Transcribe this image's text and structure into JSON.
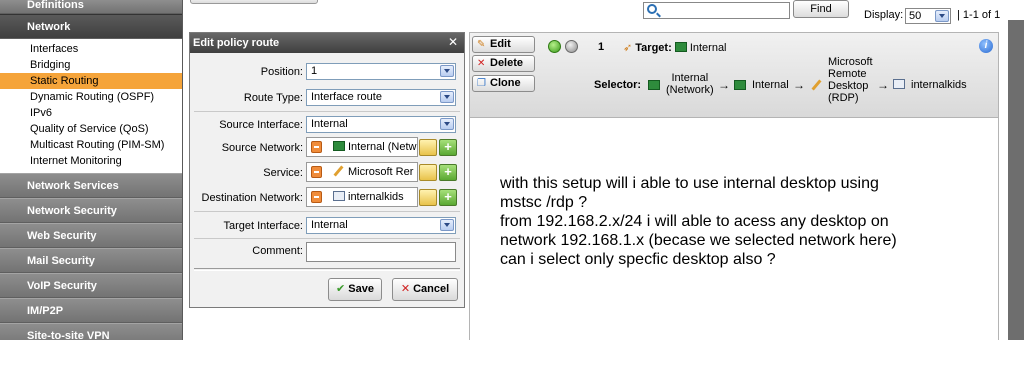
{
  "sidebar": {
    "sections": [
      {
        "label": "Definitions"
      },
      {
        "label": "Network"
      },
      {
        "label": "Network Services"
      },
      {
        "label": "Network Security"
      },
      {
        "label": "Web Security"
      },
      {
        "label": "Mail Security"
      },
      {
        "label": "VoIP Security"
      },
      {
        "label": "IM/P2P"
      },
      {
        "label": "Site-to-site VPN"
      }
    ],
    "network_items": [
      {
        "label": "Interfaces"
      },
      {
        "label": "Bridging"
      },
      {
        "label": "Static Routing"
      },
      {
        "label": "Dynamic Routing (OSPF)"
      },
      {
        "label": "IPv6"
      },
      {
        "label": "Quality of Service (QoS)"
      },
      {
        "label": "Multicast Routing (PIM-SM)"
      },
      {
        "label": "Internet Monitoring"
      }
    ],
    "active_item": "Static Routing",
    "colors": {
      "active_item": "#f5a43a",
      "sidebar_bg": "#7d7d7d"
    }
  },
  "toolbar": {
    "search_value": "",
    "find_label": "Find",
    "display_label": "Display:",
    "display_value": "50",
    "pager_text": "| 1-1 of 1"
  },
  "dialog": {
    "title": "Edit policy route",
    "close_glyph": "✕",
    "fields": {
      "position_label": "Position:",
      "position_value": "1",
      "route_type_label": "Route Type:",
      "route_type_value": "Interface route",
      "source_interface_label": "Source Interface:",
      "source_interface_value": "Internal",
      "source_network_label": "Source Network:",
      "source_network_value": "Internal (Netw",
      "service_label": "Service:",
      "service_value": "Microsoft Rer",
      "destination_network_label": "Destination Network:",
      "destination_network_value": "internalkids",
      "target_interface_label": "Target Interface:",
      "target_interface_value": "Internal",
      "comment_label": "Comment:",
      "comment_value": ""
    },
    "save_label": "Save",
    "cancel_label": "Cancel"
  },
  "rule": {
    "edit_label": "Edit",
    "delete_label": "Delete",
    "clone_label": "Clone",
    "number": "1",
    "target_label": "Target:",
    "target_value": "Internal",
    "selector_label": "Selector:",
    "selector_source_line1": "Internal",
    "selector_source_line2": "(Network)",
    "selector_interface": "Internal",
    "selector_service_line1": "Microsoft",
    "selector_service_line2": "Remote",
    "selector_service_line3": "Desktop",
    "selector_service_line4": "(RDP)",
    "selector_destination": "internalkids",
    "arrow": "→",
    "info_glyph": "i"
  },
  "question": {
    "line1": "with this setup will i able to use internal desktop using",
    "line2": "mstsc /rdp ?",
    "line3": "from 192.168.2.x/24 i will able to acess any desktop on",
    "line4": "network 192.168.1.x (becase we selected network here)",
    "line5": "can i select only specfic desktop also ?"
  }
}
